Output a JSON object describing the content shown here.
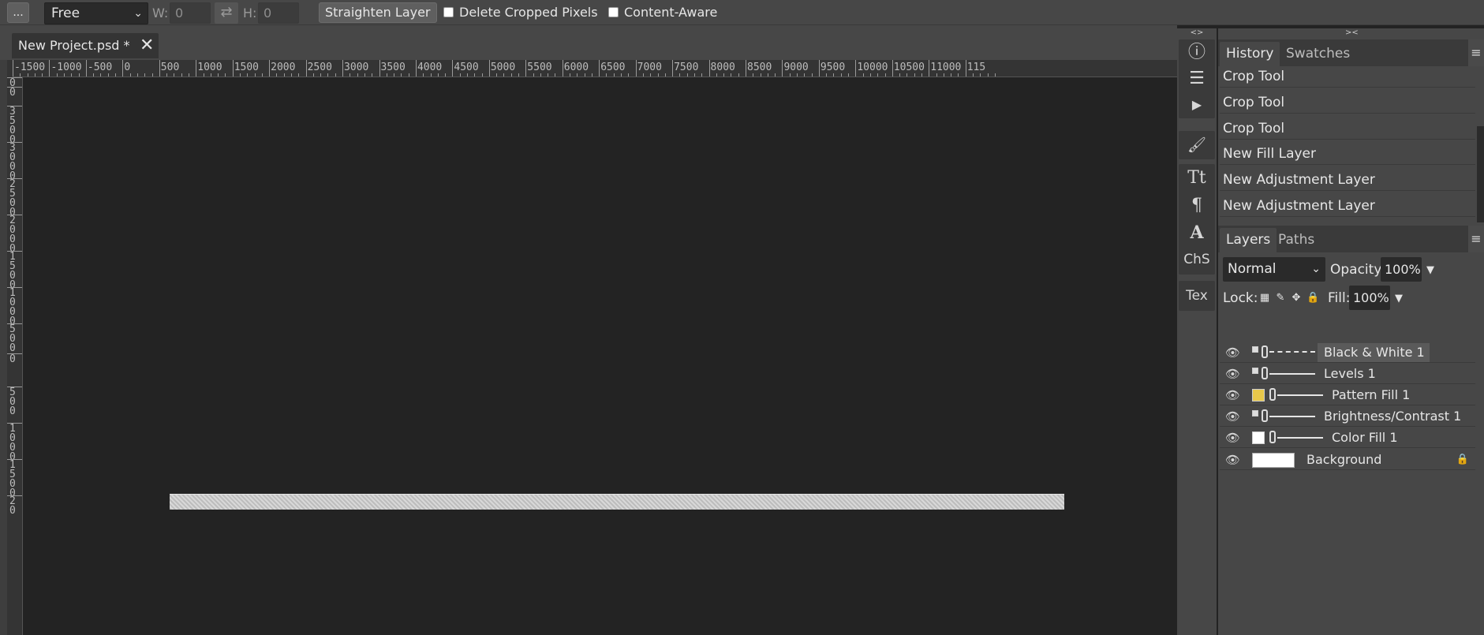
{
  "toolbar": {
    "more_label": "...",
    "ratio_value": "Free",
    "width_label": "W:",
    "width_value": "0",
    "height_label": "H:",
    "height_value": "0",
    "swap_glyph": "⇄",
    "straighten_label": "Straighten Layer",
    "delete_cropped_label": "Delete Cropped Pixels",
    "delete_cropped_checked": false,
    "content_aware_label": "Content-Aware",
    "content_aware_checked": false
  },
  "document_tab": {
    "title": "New Project.psd *",
    "close_glyph": "✕"
  },
  "ruler_h_labels": [
    "-1500",
    "-1000",
    "-500",
    "0",
    "500",
    "1000",
    "1500",
    "2000",
    "2500",
    "3000",
    "3500",
    "4000",
    "4500",
    "5000",
    "5500",
    "6000",
    "6500",
    "7000",
    "7500",
    "8000",
    "8500",
    "9000",
    "9500",
    "10000",
    "10500",
    "11000",
    "115"
  ],
  "ruler_v_labels": [
    "0",
    "0",
    "3\n5\n0\n0",
    "3\n0\n0\n0",
    "2\n5\n0\n0",
    "2\n0\n0\n0",
    "1\n5\n0\n0",
    "1\n0\n0\n0",
    "5\n0\n0",
    "0",
    "5\n0\n0",
    "1\n0\n0\n0",
    "1\n5\n0\n0",
    "2\n0"
  ],
  "icon_column": {
    "collapse_glyph": "<>",
    "buttons": [
      {
        "name": "info-icon",
        "glyph": "ⓘ"
      },
      {
        "name": "adjustments-icon",
        "glyph": "☰"
      },
      {
        "name": "play-icon",
        "glyph": "▶"
      },
      {
        "name": "brush-icon",
        "glyph": "🖌"
      },
      {
        "name": "text-icon",
        "glyph": "Tt"
      },
      {
        "name": "paragraph-icon",
        "glyph": "¶"
      },
      {
        "name": "glyph-icon",
        "glyph": "A"
      },
      {
        "name": "character-style-label",
        "glyph": "ChS"
      },
      {
        "name": "texture-label",
        "glyph": "Tex"
      }
    ]
  },
  "panels": {
    "collapse_glyph": "><",
    "history_tabs": [
      "History",
      "Swatches"
    ],
    "menu_glyph": "≡",
    "history_items": [
      "Crop Tool",
      "Crop Tool",
      "Crop Tool",
      "New Fill Layer",
      "New Adjustment Layer",
      "New Adjustment Layer"
    ],
    "layers_tabs": [
      "Layers",
      "Paths"
    ],
    "blend_mode": "Normal",
    "opacity_label": "Opacity:",
    "opacity_value": "100%",
    "lock_label": "Lock:",
    "fill_label": "Fill:",
    "fill_value": "100%",
    "dropdown_glyph": "▼",
    "layers": [
      {
        "name": "Black & White 1",
        "type": "adjustment",
        "selected": true
      },
      {
        "name": "Levels 1",
        "type": "adjustment",
        "selected": false
      },
      {
        "name": "Pattern Fill 1",
        "type": "fill",
        "thumb_color": "#e8c84a",
        "selected": false
      },
      {
        "name": "Brightness/Contrast 1",
        "type": "adjustment",
        "selected": false
      },
      {
        "name": "Color Fill 1",
        "type": "fill",
        "thumb_color": "#ffffff",
        "selected": false
      },
      {
        "name": "Background",
        "type": "background",
        "locked": true,
        "selected": false
      }
    ]
  },
  "colors": {
    "ui_bg": "#474747",
    "canvas_bg": "#232323",
    "panel_dark": "#3a3a3a"
  }
}
